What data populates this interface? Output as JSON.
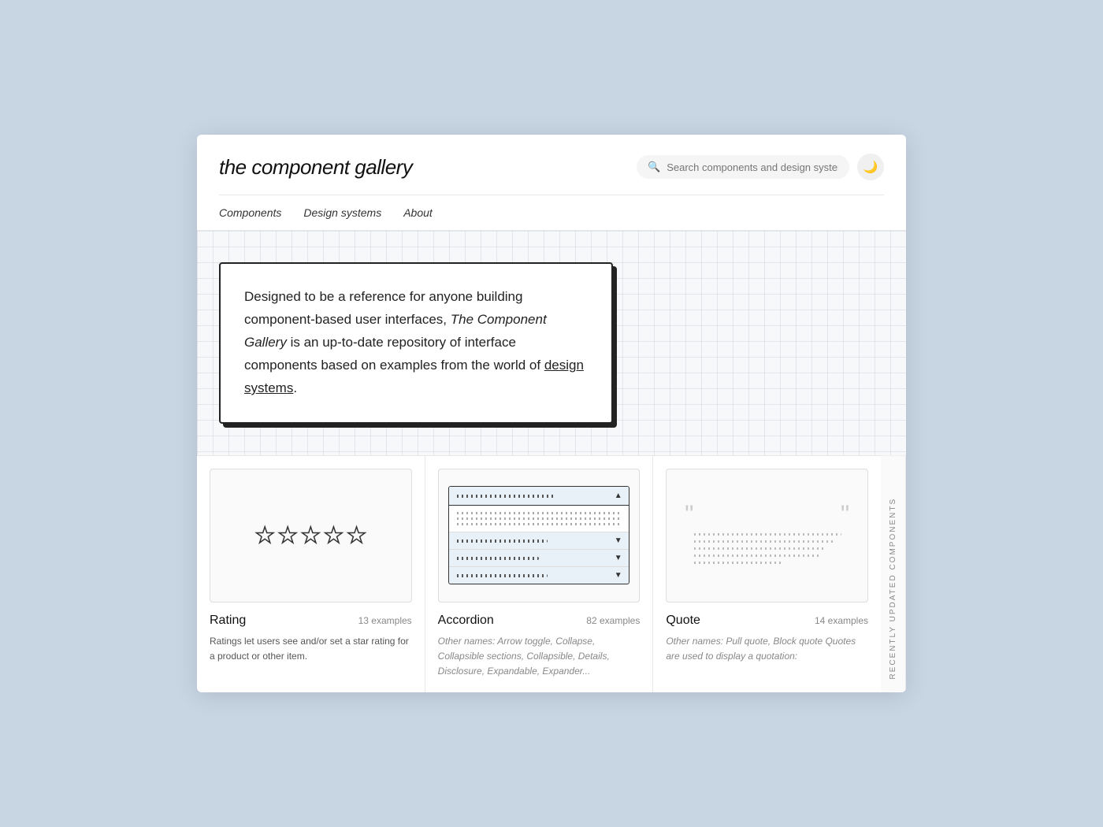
{
  "header": {
    "title": "the component gallery",
    "search": {
      "placeholder": "Search components and design systems"
    },
    "nav": [
      {
        "label": "Components",
        "id": "nav-components"
      },
      {
        "label": "Design systems",
        "id": "nav-design-systems"
      },
      {
        "label": "About",
        "id": "nav-about"
      }
    ]
  },
  "hero": {
    "text_part1": "Designed to be a reference for anyone building component-based user interfaces, ",
    "text_italic": "The Component Gallery",
    "text_part2": " is an up-to-date repository of interface components based on examples from the world of ",
    "link_text": "design systems",
    "text_end": "."
  },
  "components": {
    "sidebar_label": "Recently updated components",
    "items": [
      {
        "name": "Rating",
        "examples_count": "13 examples",
        "description": "Ratings let users see and/or set a star rating for a product or other item.",
        "other_names": null
      },
      {
        "name": "Accordion",
        "examples_count": "82 examples",
        "description": null,
        "other_names": "Other names: Arrow toggle, Collapse, Collapsible sections, Collapsible, Details, Disclosure, Expandable, Expander..."
      },
      {
        "name": "Quote",
        "examples_count": "14 examples",
        "description": null,
        "other_names": "Other names: Pull quote, Block quote\n\nQuotes are used to display a quotation:"
      }
    ]
  }
}
